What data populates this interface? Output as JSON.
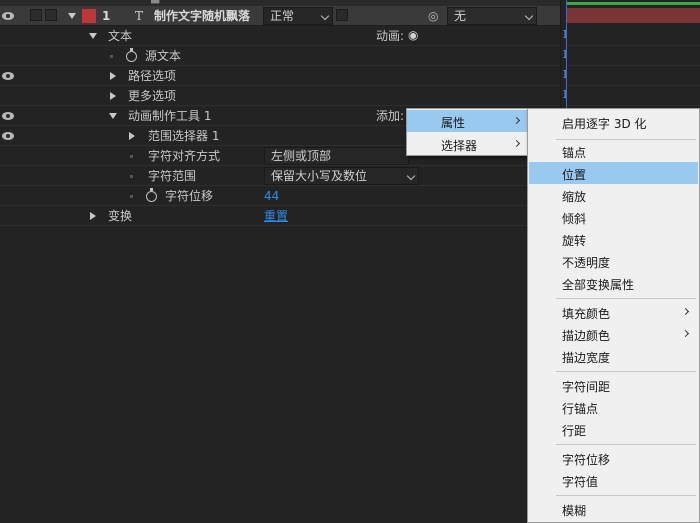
{
  "layer": {
    "number": "1",
    "type_glyph": "T",
    "name": "制作文字随机飘落",
    "mode": "正常",
    "parent": "无"
  },
  "rows": {
    "text_group": "文本",
    "animate_label": "动画:",
    "source_text": "源文本",
    "path_options": "路径选项",
    "more_options": "更多选项",
    "animator_name": "动画制作工具 1",
    "add_label": "添加:",
    "range_selector": "范围选择器 1",
    "char_alignment": "字符对齐方式",
    "char_alignment_value": "左侧或顶部",
    "char_range": "字符范围",
    "char_range_value": "保留大小写及数位",
    "char_offset": "字符位移",
    "char_offset_value": "44",
    "transform": "变换",
    "reset": "重置"
  },
  "menu_add": {
    "items": [
      "属性",
      "选择器"
    ]
  },
  "menu_property": {
    "items": [
      "启用逐字 3D 化",
      "锚点",
      "位置",
      "缩放",
      "倾斜",
      "旋转",
      "不透明度",
      "全部变换属性",
      "填充颜色",
      "描边颜色",
      "描边宽度",
      "字符间距",
      "行锚点",
      "行距",
      "字符位移",
      "字符值",
      "模糊"
    ],
    "highlighted": "位置"
  },
  "colors": {
    "layer_label": "#c0353a",
    "link": "#2d8ceb",
    "menu_highlight": "#99c9ef",
    "timeline_bar": "#7b3436",
    "work_area": "#39a845"
  },
  "icons": {
    "eye": "eye-icon",
    "stopwatch": "stopwatch-icon",
    "spiral": "pick-whip-icon",
    "play": "play-circle-icon"
  }
}
